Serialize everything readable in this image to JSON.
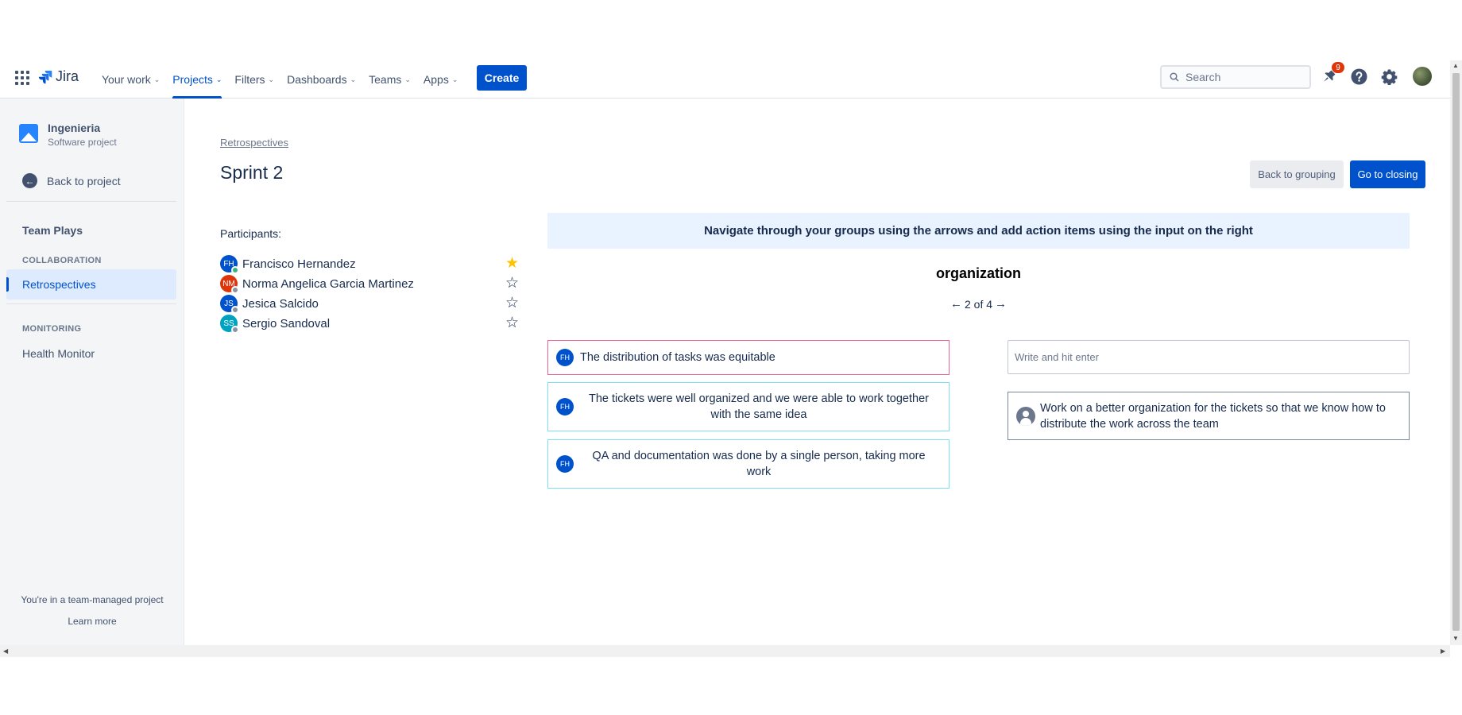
{
  "nav": {
    "logo": "Jira",
    "items": [
      {
        "label": "Your work",
        "active": false
      },
      {
        "label": "Projects",
        "active": true
      },
      {
        "label": "Filters",
        "active": false
      },
      {
        "label": "Dashboards",
        "active": false
      },
      {
        "label": "Teams",
        "active": false
      },
      {
        "label": "Apps",
        "active": false
      }
    ],
    "create_label": "Create",
    "search_placeholder": "Search",
    "notifications_count": "9",
    "colors": {
      "accent": "#0052cc",
      "badge": "#de350b"
    },
    "icons": [
      "app-switcher-icon",
      "jira-logo-icon",
      "search-icon",
      "notifications-icon",
      "help-icon",
      "settings-icon"
    ]
  },
  "sidebar": {
    "project_name": "Ingenieria",
    "project_type": "Software project",
    "back_label": "Back to project",
    "team_plays": "Team Plays",
    "collaboration_heading": "COLLABORATION",
    "retrospectives": "Retrospectives",
    "monitoring_heading": "MONITORING",
    "health_monitor": "Health Monitor",
    "footer_text": "You're in a team-managed project",
    "learn_more": "Learn more"
  },
  "main": {
    "breadcrumb": "Retrospectives",
    "title": "Sprint 2",
    "back_to_grouping": "Back to grouping",
    "go_to_closing": "Go to closing",
    "participants_label": "Participants:",
    "participants": [
      {
        "initials": "FH",
        "name": "Francisco Hernandez",
        "avatar_color": "#0052cc",
        "status_color": "#36b37e",
        "starred": true
      },
      {
        "initials": "NM",
        "name": "Norma Angelica Garcia Martinez",
        "avatar_color": "#de350b",
        "status_color": "#8993a4",
        "starred": false
      },
      {
        "initials": "JS",
        "name": "Jesica Salcido",
        "avatar_color": "#0052cc",
        "status_color": "#8993a4",
        "starred": false
      },
      {
        "initials": "SS",
        "name": "Sergio Sandoval",
        "avatar_color": "#00a3bf",
        "status_color": "#8993a4",
        "starred": false
      }
    ],
    "info": "Navigate through your groups using the arrows and add action items using the input on the right",
    "group_title": "organization",
    "pager": "2 of 4",
    "cards": [
      {
        "initials": "FH",
        "text": "The distribution of tasks was equitable",
        "border_color": "#f06292"
      },
      {
        "initials": "FH",
        "text": "The tickets were well organized and we were able to work together with the same idea",
        "border_color": "#79e2f2"
      },
      {
        "initials": "FH",
        "text": "QA and documentation was done by a single person, taking more work",
        "border_color": "#79e2f2"
      }
    ],
    "action_placeholder": "Write and hit enter",
    "action_item": "Work on a better organization for the tickets so that we know how to distribute the work across the team"
  }
}
